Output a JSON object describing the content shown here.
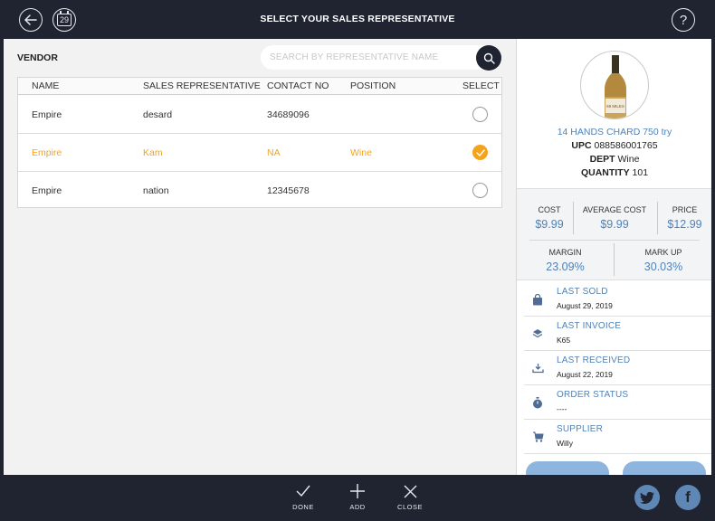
{
  "header": {
    "title": "SELECT YOUR SALES REPRESENTATIVE",
    "back_icon": "back-arrow-icon",
    "calendar_day": "29",
    "help_symbol": "?"
  },
  "vendor": {
    "label": "VENDOR",
    "search_placeholder": "SEARCH BY REPRESENTATIVE NAME"
  },
  "table": {
    "columns": [
      "NAME",
      "SALES REPRESENTATIVE",
      "CONTACT NO",
      "POSITION",
      "SELECT"
    ],
    "rows": [
      {
        "name": "Empire",
        "rep": "desard",
        "contact": "34689096",
        "position": "",
        "selected": false
      },
      {
        "name": "Empire",
        "rep": "Kam",
        "contact": "NA",
        "position": "Wine",
        "selected": true
      },
      {
        "name": "Empire",
        "rep": "nation",
        "contact": "12345678",
        "position": "",
        "selected": false
      }
    ]
  },
  "product": {
    "name": "14 HANDS CHARD 750 try",
    "upc_label": "UPC",
    "upc": "088586001765",
    "dept_label": "DEPT",
    "dept": "Wine",
    "qty_label": "QUANTITY",
    "qty": "101",
    "bottle_label": "69 MILES"
  },
  "stats": {
    "cost_label": "COST",
    "cost": "$9.99",
    "avg_cost_label": "AVERAGE COST",
    "avg_cost": "$9.99",
    "price_label": "PRICE",
    "price": "$12.99",
    "margin_label": "MARGIN",
    "margin": "23.09%",
    "markup_label": "MARK UP",
    "markup": "30.03%"
  },
  "info": [
    {
      "title": "LAST SOLD",
      "value": "August 29, 2019",
      "icon": "shopping-bag-icon"
    },
    {
      "title": "LAST INVOICE",
      "value": "K65",
      "icon": "invoice-stack-icon"
    },
    {
      "title": "LAST RECEIVED",
      "value": "August 22, 2019",
      "icon": "received-tray-icon"
    },
    {
      "title": "ORDER STATUS",
      "value": "----",
      "icon": "stopwatch-icon"
    },
    {
      "title": "SUPPLIER",
      "value": "Willy",
      "icon": "cart-icon"
    }
  ],
  "bottom": {
    "done": "DONE",
    "add": "ADD",
    "close": "CLOSE"
  },
  "social": {
    "facebook": "f"
  },
  "colors": {
    "dark": "#1f2430",
    "accent_orange": "#f5a31a",
    "accent_blue": "#4f82b9"
  }
}
